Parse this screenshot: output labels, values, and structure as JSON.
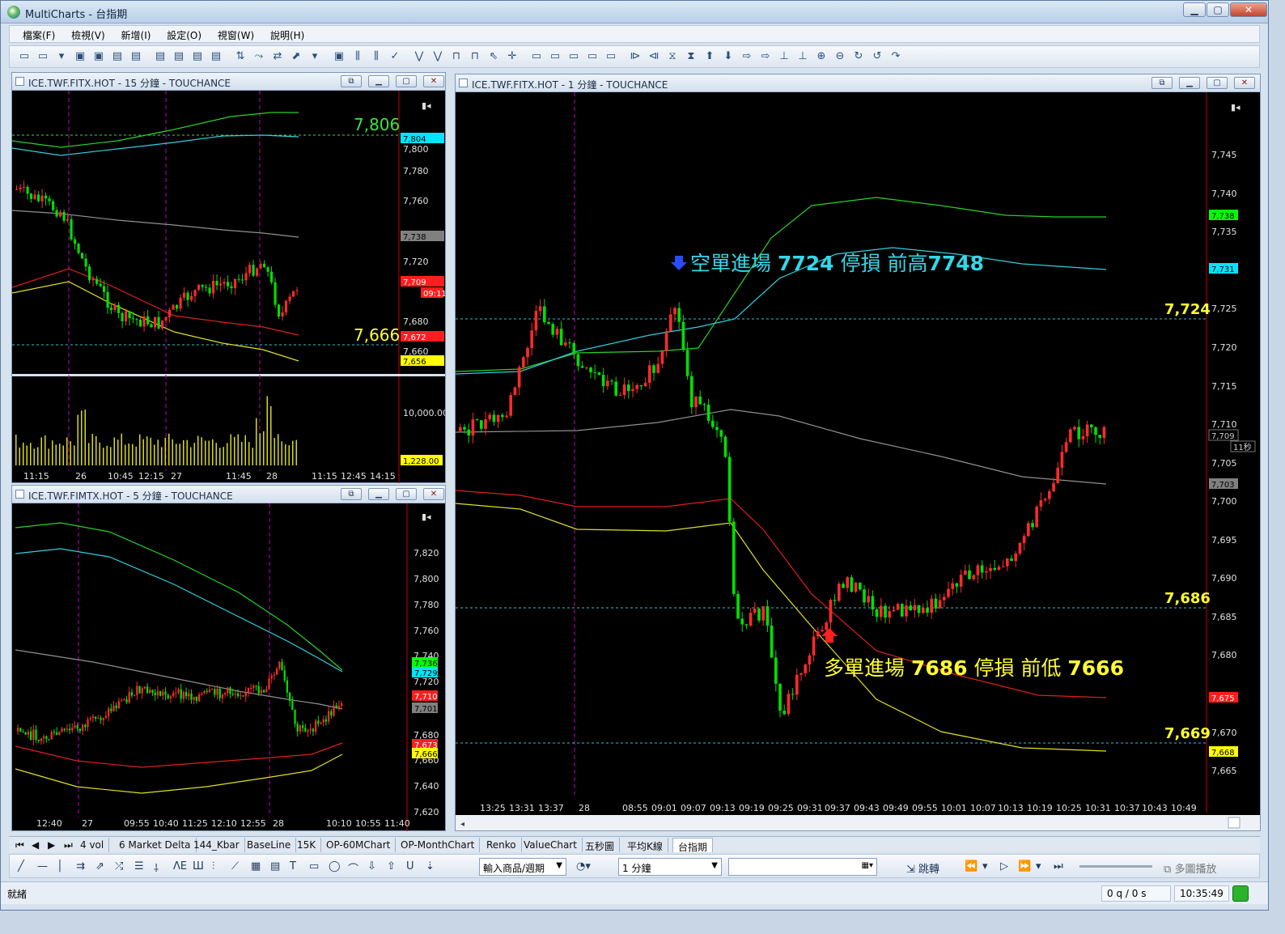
{
  "window": {
    "title": "MultiCharts - 台指期",
    "minimize": "▁",
    "maximize": "▢",
    "close": "✕"
  },
  "menu": [
    "檔案(F)",
    "檢視(V)",
    "新增(I)",
    "設定(O)",
    "視窗(W)",
    "說明(H)"
  ],
  "charts": {
    "top_left": {
      "title": "ICE.TWF.FITX.HOT - 15 分鐘 - TOUCHANCE",
      "price_labels": [
        "7,800",
        "7,780",
        "7,760",
        "7,720",
        "7,680",
        "7,660"
      ],
      "volume_label": "10,000.00",
      "tags": [
        {
          "text": "7,804",
          "color": "#00e5ff"
        },
        {
          "text": "7,738",
          "color": "#808080"
        },
        {
          "text": "7,709",
          "color": "#ff1e1e"
        },
        {
          "text": "09:11",
          "color": "#ff1e1e"
        },
        {
          "text": "7,672",
          "color": "#ff1e1e"
        },
        {
          "text": "7,656",
          "color": "#ffff00"
        },
        {
          "text": "1,228.00",
          "color": "#ffff00"
        }
      ],
      "level_high": "7,806",
      "level_low": "7,666",
      "time_labels": [
        "11:15",
        "26",
        "10:45",
        "12:15",
        "27",
        "11:45",
        "28",
        "11:15",
        "12:45",
        "14:15"
      ]
    },
    "bottom_left": {
      "title": "ICE.TWF.FIMTX.HOT - 5 分鐘 - TOUCHANCE",
      "price_labels": [
        "7,820",
        "7,800",
        "7,780",
        "7,760",
        "7,740",
        "7,720",
        "7,680",
        "7,660",
        "7,640",
        "7,620"
      ],
      "tags": [
        {
          "text": "7,736",
          "color": "#00ff00"
        },
        {
          "text": "7,729",
          "color": "#00e5ff"
        },
        {
          "text": "7,710",
          "color": "#ff1e1e"
        },
        {
          "text": "7,701",
          "color": "#808080"
        },
        {
          "text": "7,673",
          "color": "#ff1e1e"
        },
        {
          "text": "7,666",
          "color": "#ffff00"
        }
      ],
      "time_labels": [
        "12:40",
        "27",
        "09:55",
        "10:40",
        "11:25",
        "12:10",
        "12:55",
        "28",
        "10:10",
        "10:55",
        "11:40"
      ]
    },
    "main": {
      "title": "ICE.TWF.FITX.HOT - 1 分鐘 - TOUCHANCE",
      "price_labels": [
        "7,745",
        "7,740",
        "7,735",
        "7,725",
        "7,720",
        "7,715",
        "7,710",
        "7,705",
        "7,700",
        "7,695",
        "7,690",
        "7,685",
        "7,680",
        "7,670",
        "7,665"
      ],
      "tags": [
        {
          "text": "7,738",
          "color": "#00ff00"
        },
        {
          "text": "7,731",
          "color": "#00e5ff"
        },
        {
          "text": "7,709",
          "color": "#000000"
        },
        {
          "text": "11秒",
          "color": "#000000"
        },
        {
          "text": "7,703",
          "color": "#808080"
        },
        {
          "text": "7,675",
          "color": "#ff1e1e"
        },
        {
          "text": "7,668",
          "color": "#ffff00"
        }
      ],
      "levels": [
        "7,724",
        "7,686",
        "7,669"
      ],
      "short_note": {
        "prefix": "空單進場 ",
        "price": "7724",
        "mid": " 停損 前高",
        "stop": "7748"
      },
      "long_note": {
        "prefix": "多單進場 ",
        "price": "7686",
        "mid": " 停損 前低 ",
        "stop": "7666"
      },
      "time_labels": [
        "13:25",
        "13:31",
        "13:37",
        "28",
        "08:55",
        "09:01",
        "09:07",
        "09:13",
        "09:19",
        "09:25",
        "09:31",
        "09:37",
        "09:43",
        "09:49",
        "09:55",
        "10:01",
        "10:07",
        "10:13",
        "10:19",
        "10:25",
        "10:31",
        "10:37",
        "10:43",
        "10:49"
      ]
    }
  },
  "tabs": [
    "4 vol",
    "6 Market Delta",
    "144_Kbar",
    "BaseLine",
    "15K",
    "OP-60MChart",
    "OP-MonthChart",
    "Renko",
    "ValueChart",
    "五秒圖",
    "平均K線",
    "台指期"
  ],
  "drawbar": {
    "symbol_select": "輸入商品/週期",
    "interval_select": "1 分鐘",
    "jump_label": "跳轉",
    "playback_label": "多圖播放"
  },
  "status": {
    "ready": "就緒",
    "queue": "0 q / 0 s",
    "time": "10:35:49"
  }
}
